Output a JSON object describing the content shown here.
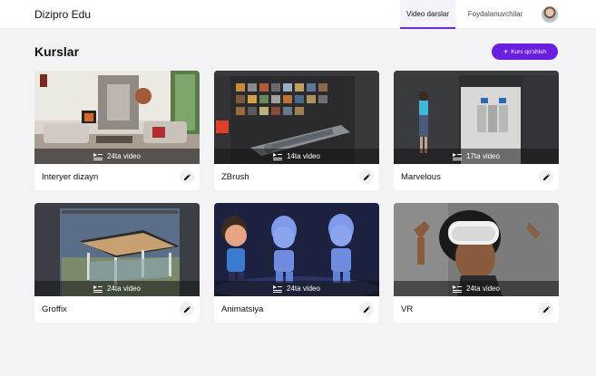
{
  "header": {
    "brand": "Dizipro Edu",
    "tabs": [
      {
        "label": "Video darslar",
        "active": true
      },
      {
        "label": "Foydalanuvchilar",
        "active": false
      }
    ]
  },
  "main": {
    "title": "Kurslar",
    "add_button": {
      "label": "Kurs qo'shish",
      "icon": "plus-icon"
    }
  },
  "courses": [
    {
      "name": "Interyer dizayn",
      "count": "24ta video",
      "thumbnail": "interior-room"
    },
    {
      "name": "ZBrush",
      "count": "14ta video",
      "thumbnail": "zbrush-software"
    },
    {
      "name": "Marvelous",
      "count": "17ta video",
      "thumbnail": "marvelous-software"
    },
    {
      "name": "Groffix",
      "count": "24ta video",
      "thumbnail": "pavilion-render"
    },
    {
      "name": "Animatsiya",
      "count": "24ta video",
      "thumbnail": "animated-characters"
    },
    {
      "name": "VR",
      "count": "24ta video",
      "thumbnail": "vr-headset-person"
    }
  ],
  "colors": {
    "accent": "#6a1fe0",
    "active_tab_underline": "#6a2bd9",
    "background": "#f3f3f5"
  }
}
